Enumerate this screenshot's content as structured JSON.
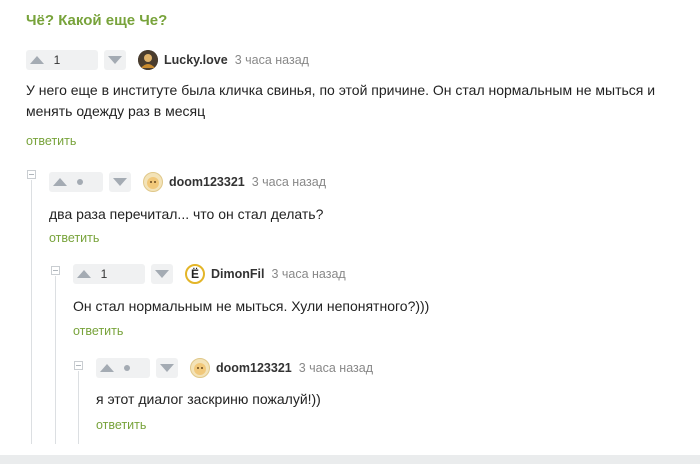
{
  "post_title": "Чё? Какой еще Че?",
  "comments": [
    {
      "author": "Lucky.love",
      "time": "3 часа назад",
      "votes": "1",
      "text": "У него еще в институте была кличка свинья, по этой причине. Он стал нормальным не мыться и менять одежду раз в месяц",
      "reply_label": "ответить",
      "avatar_icon": "lucky-love-avatar-icon"
    },
    {
      "author": "doom123321",
      "time": "3 часа назад",
      "votes": "",
      "text": "два раза перечитал... что он стал делать?",
      "reply_label": "ответить",
      "avatar_icon": "doom-avatar-icon"
    },
    {
      "author": "DimonFil",
      "time": "3 часа назад",
      "votes": "1",
      "avatar_letter": "Ё",
      "text": "Он стал нормальным не мыться. Хули непонятного?)))",
      "reply_label": "ответить",
      "avatar_icon": "dimonfil-avatar-icon"
    },
    {
      "author": "doom123321",
      "time": "3 часа назад",
      "votes": "",
      "text": "я этот диалог заскриню пожалуй!))",
      "reply_label": "ответить",
      "avatar_icon": "doom-avatar-icon"
    }
  ],
  "colors": {
    "accent_green": "#78a33b",
    "vote_bg": "#f0f1f2",
    "arrow_gray": "#a4abb3"
  }
}
